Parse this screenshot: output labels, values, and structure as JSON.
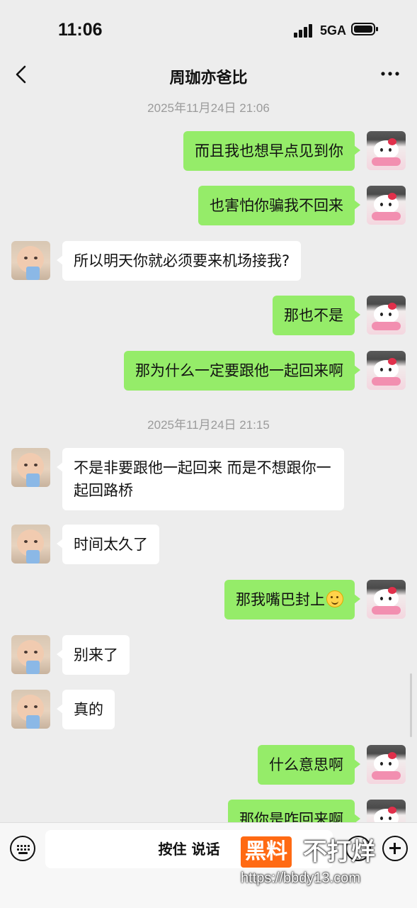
{
  "status_bar": {
    "time": "11:06",
    "network": "5GA"
  },
  "header": {
    "title": "周珈亦爸比"
  },
  "timestamps": [
    "2025年11月24日 21:06",
    "2025年11月24日 21:15"
  ],
  "messages": [
    {
      "sender": "me",
      "text": "而且我也想早点见到你"
    },
    {
      "sender": "me",
      "text": "也害怕你骗我不回来"
    },
    {
      "sender": "them",
      "text": "所以明天你就必须要来机场接我?"
    },
    {
      "sender": "me",
      "text": "那也不是"
    },
    {
      "sender": "me",
      "text": "那为什么一定要跟他一起回来啊"
    },
    {
      "sender": "them",
      "text": "不是非要跟他一起回来 而是不想跟你一起回路桥"
    },
    {
      "sender": "them",
      "text": "时间太久了"
    },
    {
      "sender": "me",
      "text": "那我嘴巴封上",
      "emoji": "grinning-face"
    },
    {
      "sender": "them",
      "text": "别来了"
    },
    {
      "sender": "them",
      "text": "真的"
    },
    {
      "sender": "me",
      "text": "什么意思啊"
    },
    {
      "sender": "me",
      "text": "那你是咋回来啊"
    }
  ],
  "input_bar": {
    "voice_label": "按住 说话"
  },
  "watermark": {
    "badge": "黑料",
    "text": "不打烊",
    "url": "https://bbdy13.com"
  },
  "colors": {
    "my_bubble": "#95ec69",
    "their_bubble": "#ffffff",
    "background": "#ededed"
  }
}
